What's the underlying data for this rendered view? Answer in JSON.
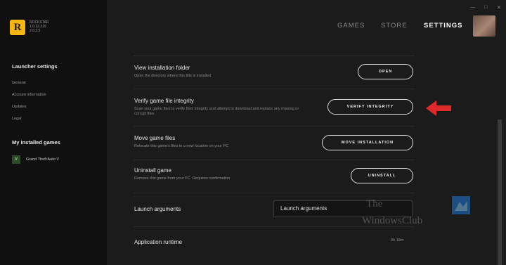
{
  "sidebar": {
    "logo_letter": "R",
    "logo_lines": [
      "ROCKSTAR",
      "1.0.33.319",
      "2.0.2.5"
    ],
    "settings_heading": "Launcher settings",
    "settings_links": [
      "General",
      "Account information",
      "Updates",
      "Legal"
    ],
    "games_heading": "My installed games",
    "game_label": "Grand Theft Auto V",
    "game_icon_text": "V"
  },
  "topnav": {
    "games": "GAMES",
    "store": "STORE",
    "settings": "SETTINGS"
  },
  "rows": {
    "view_title": "View installation folder",
    "view_desc": "Open the directory where this title is installed",
    "view_button": "OPEN",
    "verify_title": "Verify game file integrity",
    "verify_desc": "Scan your game files to verify their integrity and attempt to download and replace any missing or corrupt files",
    "verify_button": "VERIFY INTEGRITY",
    "move_title": "Move game files",
    "move_desc": "Relocate this game's files to a new location on your PC",
    "move_button": "MOVE INSTALLATION",
    "uninstall_title": "Uninstall game",
    "uninstall_desc": "Remove this game from your PC. Requires confirmation",
    "uninstall_button": "UNINSTALL",
    "launch_title": "Launch arguments",
    "launch_value": "Launch arguments",
    "runtime_title": "Application runtime",
    "runtime_value": "9h 18m"
  },
  "watermark": {
    "line1": "The",
    "line2": "WindowsClub"
  },
  "colors": {
    "accent": "#f5b60f",
    "arrow": "#e02a2a",
    "bg": "#1b1b1b",
    "sidebar": "#101010"
  }
}
